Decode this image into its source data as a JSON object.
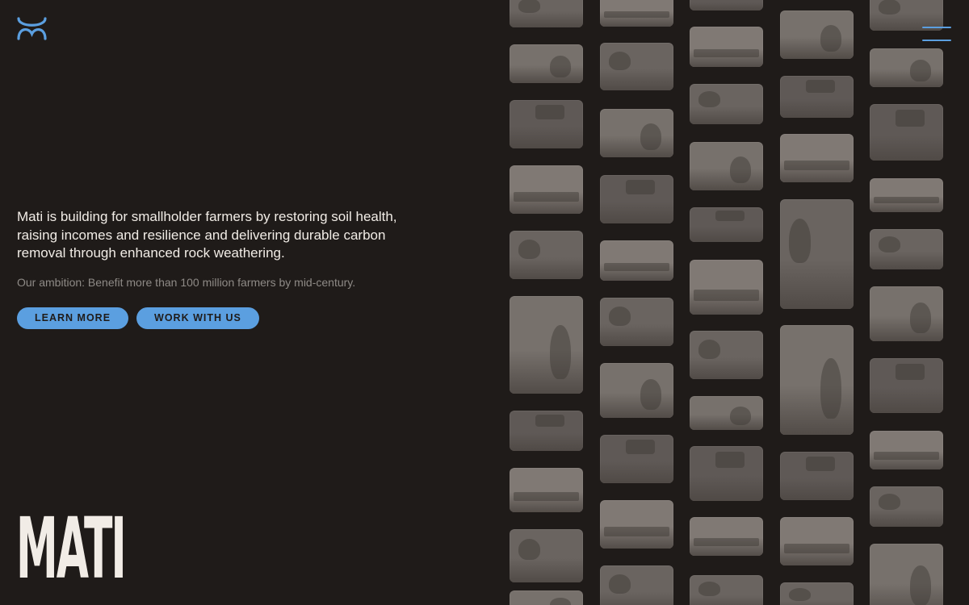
{
  "brand": {
    "logo_icon": "mati-wave-logo-icon",
    "wordmark": "MATI",
    "accent_color": "#5b9fe0",
    "background_color": "#1f1b19",
    "text_color": "#f1ece6"
  },
  "nav": {
    "menu_icon": "hamburger-menu-icon"
  },
  "hero": {
    "text": "Mati is building for smallholder farmers by restoring soil health, raising incomes and resilience and delivering durable carbon removal through enhanced rock weathering.",
    "subtext": "Our ambition: Benefit more than 100 million farmers by mid-century.",
    "buttons": [
      {
        "label": "LEARN MORE"
      },
      {
        "label": "WORK WITH US"
      }
    ]
  },
  "gallery": {
    "photo_subjects": [
      "farm-field-photo",
      "farmer-group-photo",
      "field-work-photo",
      "rock-crusher-photo",
      "village-meeting-photo",
      "planting-photo",
      "lab-work-photo",
      "community-photo"
    ]
  }
}
